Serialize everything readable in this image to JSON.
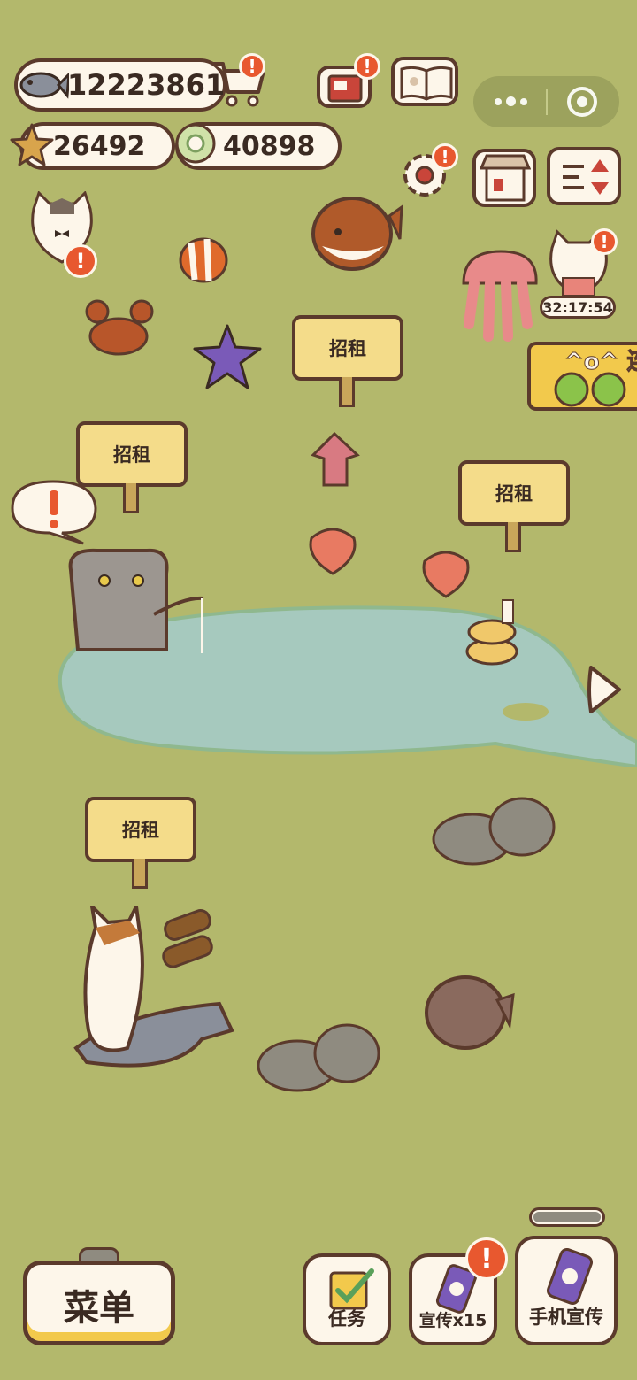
{
  "currency": {
    "fish": "12223861",
    "stars": "26492",
    "coins": "40898"
  },
  "timer": "32:17:54",
  "banner": {
    "text": "^o^ 连"
  },
  "signs": [
    "招租",
    "招租",
    "招租",
    "招租"
  ],
  "alert": "!",
  "bottom": {
    "menu": "菜单",
    "tasks": "任务",
    "promote": "宣传x15",
    "phone_promote": "手机宣传"
  },
  "colors": {
    "grass": "#b3b86c",
    "pond": "#a6c9be",
    "outline": "#5b3a2c",
    "badge": "#e8582f",
    "sign": "#f4dc8a"
  }
}
